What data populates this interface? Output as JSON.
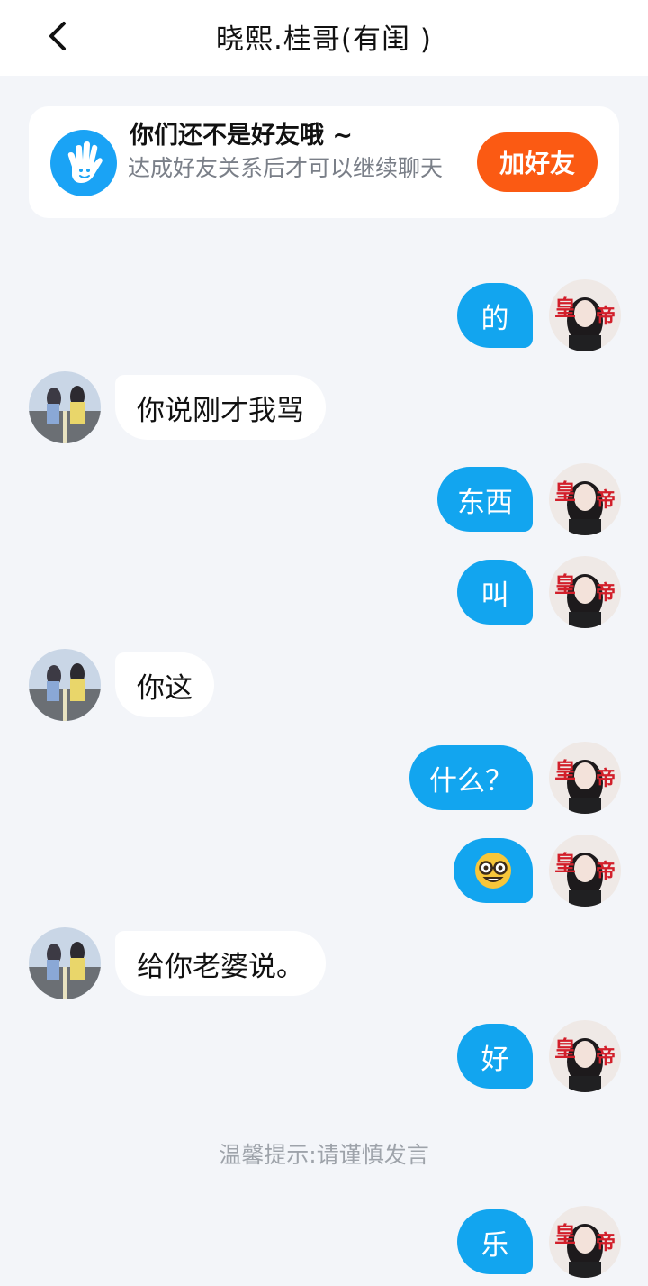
{
  "header": {
    "title": "晓熙.桂哥(有闺 )"
  },
  "banner": {
    "title": "你们还不是好友哦 ~",
    "description": "达成好友关系后才可以继续聊天",
    "add_button_label": "加好友"
  },
  "messages": [
    {
      "side": "right",
      "text": "的"
    },
    {
      "side": "left",
      "text": "你说刚才我骂"
    },
    {
      "side": "right",
      "text": "东西"
    },
    {
      "side": "right",
      "text": "叫"
    },
    {
      "side": "left",
      "text": "你这"
    },
    {
      "side": "right",
      "text": "什么？"
    },
    {
      "side": "right",
      "emoji": "nerd-face"
    },
    {
      "side": "left",
      "text": "给你老婆说。"
    },
    {
      "side": "right",
      "text": "好"
    },
    {
      "side": "right",
      "text": "乐"
    }
  ],
  "tip": "温馨提示:请谨慎发言",
  "colors": {
    "background": "#f3f5f9",
    "sent_bubble": "#12a5ef",
    "add_button": "#fb5a13",
    "banner_icon": "#1aa3f5"
  },
  "avatars": {
    "self": "avatar-self-icon",
    "peer": "avatar-peer-icon"
  }
}
